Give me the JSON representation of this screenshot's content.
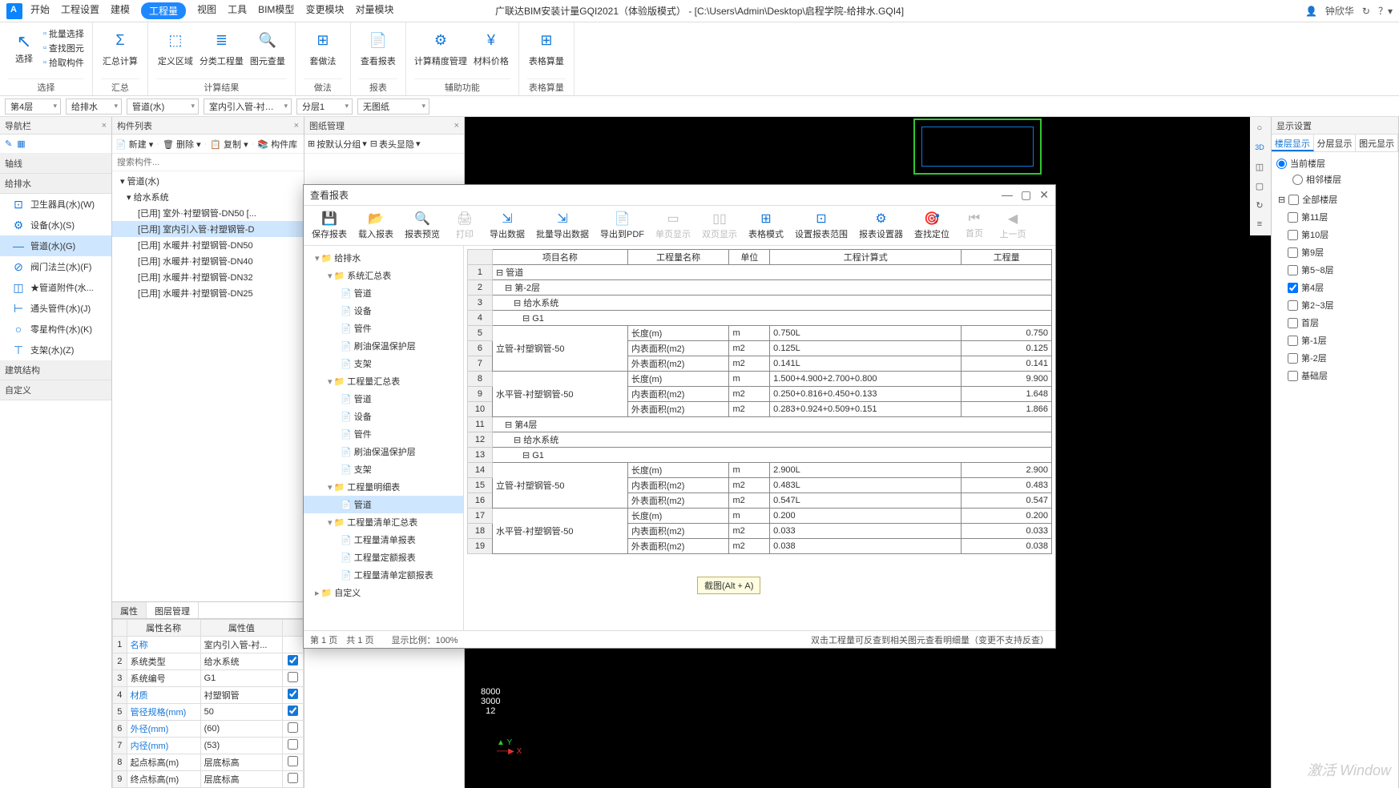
{
  "app": {
    "title": "广联达BIM安装计量GQI2021（体验版模式） - [C:\\Users\\Admin\\Desktop\\启程学院-给排水.GQI4]",
    "user": "钟欣华"
  },
  "menus": [
    "开始",
    "工程设置",
    "建模",
    "工程量",
    "视图",
    "工具",
    "BIM模型",
    "变更模块",
    "对量模块"
  ],
  "menu_active_idx": 3,
  "ribbon": {
    "select": {
      "label": "选择",
      "big": "选择",
      "items": [
        "批量选择",
        "查找图元",
        "拾取构件"
      ]
    },
    "groups": [
      {
        "label": "汇总",
        "tools": [
          {
            "icon": "Σ",
            "text": "汇总计算"
          }
        ]
      },
      {
        "label": "计算结果",
        "tools": [
          {
            "icon": "⬚",
            "text": "定义区域"
          },
          {
            "icon": "≣",
            "text": "分类工程量"
          },
          {
            "icon": "🔍",
            "text": "图元查量"
          }
        ]
      },
      {
        "label": "做法",
        "tools": [
          {
            "icon": "⊞",
            "text": "套做法"
          }
        ]
      },
      {
        "label": "报表",
        "tools": [
          {
            "icon": "📄",
            "text": "查看报表"
          }
        ]
      },
      {
        "label": "辅助功能",
        "tools": [
          {
            "icon": "⚙",
            "text": "计算精度管理"
          },
          {
            "icon": "¥",
            "text": "材料价格"
          }
        ]
      },
      {
        "label": "表格算量",
        "tools": [
          {
            "icon": "⊞",
            "text": "表格算量"
          }
        ]
      }
    ]
  },
  "filters": {
    "floor": "第4层",
    "system": "给排水",
    "pipe": "管道(水)",
    "component": "室内引入管-衬…",
    "layer": "分层1",
    "drawing": "无图纸"
  },
  "nav": {
    "title": "导航栏",
    "sections": [
      {
        "name": "轴线",
        "items": []
      },
      {
        "name": "给排水",
        "items": [
          {
            "icon": "⊡",
            "text": "卫生器具(水)(W)"
          },
          {
            "icon": "⚙",
            "text": "设备(水)(S)"
          },
          {
            "icon": "—",
            "text": "管道(水)(G)",
            "active": true
          },
          {
            "icon": "⊘",
            "text": "阀门法兰(水)(F)"
          },
          {
            "icon": "◫",
            "text": "★管道附件(水..."
          },
          {
            "icon": "⊢",
            "text": "通头管件(水)(J)"
          },
          {
            "icon": "○",
            "text": "零星构件(水)(K)"
          },
          {
            "icon": "⊤",
            "text": "支架(水)(Z)"
          }
        ]
      },
      {
        "name": "建筑结构",
        "items": []
      },
      {
        "name": "自定义",
        "items": []
      }
    ]
  },
  "comp": {
    "title": "构件列表",
    "tools": [
      "新建",
      "删除",
      "复制",
      "构件库"
    ],
    "search_placeholder": "搜索构件...",
    "tree": [
      {
        "lvl": 0,
        "text": "▾ 管道(水)"
      },
      {
        "lvl": 1,
        "text": "▾ 给水系统"
      },
      {
        "lvl": 2,
        "text": "[已用] 室外·衬塑钢管-DN50 [..."
      },
      {
        "lvl": 2,
        "text": "[已用] 室内引入管·衬塑钢管-D",
        "sel": true
      },
      {
        "lvl": 2,
        "text": "[已用] 水暖井·衬塑钢管-DN50"
      },
      {
        "lvl": 2,
        "text": "[已用] 水暖井·衬塑钢管-DN40"
      },
      {
        "lvl": 2,
        "text": "[已用] 水暖井·衬塑钢管-DN32"
      },
      {
        "lvl": 2,
        "text": "[已用] 水暖井·衬塑钢管-DN25"
      }
    ]
  },
  "props": {
    "tabs": [
      "属性",
      "图层管理"
    ],
    "headers": [
      "",
      "属性名称",
      "属性值",
      ""
    ],
    "rows": [
      {
        "n": "1",
        "name": "名称",
        "val": "室内引入管-衬...",
        "link": true,
        "cb": null
      },
      {
        "n": "2",
        "name": "系统类型",
        "val": "给水系统",
        "cb": true
      },
      {
        "n": "3",
        "name": "系统编号",
        "val": "G1",
        "cb": false
      },
      {
        "n": "4",
        "name": "材质",
        "val": "衬塑钢管",
        "link": true,
        "cb": true
      },
      {
        "n": "5",
        "name": "管径规格(mm)",
        "val": "50",
        "link": true,
        "cb": true
      },
      {
        "n": "6",
        "name": "外径(mm)",
        "val": "(60)",
        "link": true,
        "cb": false
      },
      {
        "n": "7",
        "name": "内径(mm)",
        "val": "(53)",
        "link": true,
        "cb": false
      },
      {
        "n": "8",
        "name": "起点标高(m)",
        "val": "层底标高",
        "cb": false
      },
      {
        "n": "9",
        "name": "终点标高(m)",
        "val": "层底标高",
        "cb": false
      }
    ]
  },
  "drawpanel": {
    "title": "图纸管理",
    "tools": [
      "按默认分组",
      "表头显隐"
    ]
  },
  "dialog": {
    "title": "查看报表",
    "toolbar": [
      {
        "icon": "💾",
        "text": "保存报表"
      },
      {
        "icon": "📂",
        "text": "载入报表"
      },
      {
        "icon": "🔍",
        "text": "报表预览"
      },
      {
        "icon": "🖨",
        "text": "打印",
        "dis": true
      },
      {
        "icon": "⇲",
        "text": "导出数据"
      },
      {
        "icon": "⇲",
        "text": "批量导出数据"
      },
      {
        "icon": "📄",
        "text": "导出到PDF"
      },
      {
        "icon": "▭",
        "text": "单页显示",
        "dis": true
      },
      {
        "icon": "▯▯",
        "text": "双页显示",
        "dis": true
      },
      {
        "icon": "⊞",
        "text": "表格模式"
      },
      {
        "icon": "⊡",
        "text": "设置报表范围"
      },
      {
        "icon": "⚙",
        "text": "报表设置器"
      },
      {
        "icon": "🎯",
        "text": "查找定位"
      },
      {
        "icon": "⏮",
        "text": "首页",
        "dis": true
      },
      {
        "icon": "◀",
        "text": "上一页",
        "dis": true
      }
    ],
    "tree": [
      {
        "lvl": 0,
        "text": "给排水",
        "fold": "▾",
        "folder": true
      },
      {
        "lvl": 1,
        "text": "系统汇总表",
        "fold": "▾",
        "folder": true
      },
      {
        "lvl": 2,
        "text": "管道"
      },
      {
        "lvl": 2,
        "text": "设备"
      },
      {
        "lvl": 2,
        "text": "管件"
      },
      {
        "lvl": 2,
        "text": "刷油保温保护层"
      },
      {
        "lvl": 2,
        "text": "支架"
      },
      {
        "lvl": 1,
        "text": "工程量汇总表",
        "fold": "▾",
        "folder": true
      },
      {
        "lvl": 2,
        "text": "管道"
      },
      {
        "lvl": 2,
        "text": "设备"
      },
      {
        "lvl": 2,
        "text": "管件"
      },
      {
        "lvl": 2,
        "text": "刷油保温保护层"
      },
      {
        "lvl": 2,
        "text": "支架"
      },
      {
        "lvl": 1,
        "text": "工程量明细表",
        "fold": "▾",
        "folder": true
      },
      {
        "lvl": 2,
        "text": "管道",
        "sel": true
      },
      {
        "lvl": 1,
        "text": "工程量清单汇总表",
        "fold": "▾",
        "folder": true
      },
      {
        "lvl": 2,
        "text": "工程量清单报表"
      },
      {
        "lvl": 2,
        "text": "工程量定额报表"
      },
      {
        "lvl": 2,
        "text": "工程量清单定额报表"
      },
      {
        "lvl": 0,
        "text": "自定义",
        "fold": "▸",
        "folder": true
      }
    ],
    "report": {
      "headers": [
        "项目名称",
        "工程量名称",
        "单位",
        "工程计算式",
        "工程量"
      ],
      "rows": [
        {
          "n": "1",
          "type": "g",
          "span": 5,
          "t": "⊟ 管道"
        },
        {
          "n": "2",
          "type": "g",
          "span": 5,
          "t": "　⊟ 第-2层"
        },
        {
          "n": "3",
          "type": "g",
          "span": 5,
          "t": "　　⊟ 给水系统"
        },
        {
          "n": "4",
          "type": "g",
          "span": 5,
          "t": "　　　⊟ G1"
        },
        {
          "n": "5",
          "type": "d",
          "proj": "立管-衬塑钢管-50",
          "projrows": 3,
          "name": "长度(m)",
          "unit": "m",
          "calc": "0.750L",
          "val": "0.750"
        },
        {
          "n": "6",
          "type": "d",
          "name": "内表面积(m2)",
          "unit": "m2",
          "calc": "0.125L",
          "val": "0.125"
        },
        {
          "n": "7",
          "type": "d",
          "name": "外表面积(m2)",
          "unit": "m2",
          "calc": "0.141L",
          "val": "0.141"
        },
        {
          "n": "8",
          "type": "d",
          "proj": "水平管-衬塑钢管-50",
          "projrows": 3,
          "name": "长度(m)",
          "unit": "m",
          "calc": "1.500+4.900+2.700+0.800",
          "val": "9.900"
        },
        {
          "n": "9",
          "type": "d",
          "name": "内表面积(m2)",
          "unit": "m2",
          "calc": "0.250+0.816+0.450+0.133",
          "val": "1.648"
        },
        {
          "n": "10",
          "type": "d",
          "name": "外表面积(m2)",
          "unit": "m2",
          "calc": "0.283+0.924+0.509+0.151",
          "val": "1.866"
        },
        {
          "n": "11",
          "type": "g",
          "span": 5,
          "t": "　⊟ 第4层"
        },
        {
          "n": "12",
          "type": "g",
          "span": 5,
          "t": "　　⊟ 给水系统"
        },
        {
          "n": "13",
          "type": "g",
          "span": 5,
          "t": "　　　⊟ G1"
        },
        {
          "n": "14",
          "type": "d",
          "proj": "立管-衬塑钢管-50",
          "projrows": 3,
          "name": "长度(m)",
          "unit": "m",
          "calc": "2.900L",
          "val": "2.900"
        },
        {
          "n": "15",
          "type": "d",
          "name": "内表面积(m2)",
          "unit": "m2",
          "calc": "0.483L",
          "val": "0.483"
        },
        {
          "n": "16",
          "type": "d",
          "name": "外表面积(m2)",
          "unit": "m2",
          "calc": "0.547L",
          "val": "0.547"
        },
        {
          "n": "17",
          "type": "d",
          "proj": "水平管-衬塑钢管-50",
          "projrows": 3,
          "name": "长度(m)",
          "unit": "m",
          "calc": "0.200",
          "val": "0.200"
        },
        {
          "n": "18",
          "type": "d",
          "name": "内表面积(m2)",
          "unit": "m2",
          "calc": "0.033",
          "val": "0.033"
        },
        {
          "n": "19",
          "type": "d",
          "name": "外表面积(m2)",
          "unit": "m2",
          "calc": "0.038",
          "val": "0.038"
        }
      ]
    },
    "status_left": "第 1 页　共 1 页　　显示比例：100%",
    "status_right": "双击工程量可反查到相关图元查看明细量（变更不支持反查）"
  },
  "tooltip": "截图(Alt + A)",
  "disp": {
    "title": "显示设置",
    "tabs": [
      "楼层显示",
      "分层显示",
      "图元显示"
    ],
    "radio": [
      "当前楼层",
      "相邻楼层"
    ],
    "floors_header": "全部楼层",
    "floors": [
      {
        "name": "第11层",
        "chk": false
      },
      {
        "name": "第10层",
        "chk": false
      },
      {
        "name": "第9层",
        "chk": false
      },
      {
        "name": "第5~8层",
        "chk": false
      },
      {
        "name": "第4层",
        "chk": true
      },
      {
        "name": "第2~3层",
        "chk": false
      },
      {
        "name": "首层",
        "chk": false
      },
      {
        "name": "第-1层",
        "chk": false
      },
      {
        "name": "第-2层",
        "chk": false
      },
      {
        "name": "基础层",
        "chk": false
      }
    ]
  },
  "watermark": "激活 Window"
}
